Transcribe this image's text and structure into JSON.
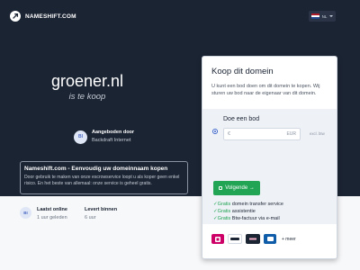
{
  "brand": {
    "name": "NAMESHIFT.COM"
  },
  "language": {
    "code": "NL",
    "flag_colors": [
      "#ae1c28",
      "#ffffff",
      "#21468b"
    ]
  },
  "hero": {
    "domain": "groener.nl",
    "tagline": "is te koop",
    "seller": {
      "initials": "BI",
      "title": "Aangeboden door",
      "name": "Backdraft Internet"
    }
  },
  "info": {
    "title": "Nameshift.com - Eenvoudig uw domeinnaam kopen",
    "text": "Door gebruik te maken van onze escrowservice loopt u als koper geen enkel risico. En het beste van allemaal: onze service is geheel gratis."
  },
  "footer": {
    "online": {
      "initials": "BI",
      "title": "Laatst online",
      "value": "1 uur geleden"
    },
    "delivery": {
      "title": "Levert binnen",
      "value": "6 uur"
    }
  },
  "card": {
    "title": "Koop dit domein",
    "text": "U kunt een bod doen om dit domein te kopen. Wij sturen uw bod naar de eigenaar van dit domein.",
    "bid_label": "Doe een bod",
    "currency": "€",
    "bid_placeholder": "",
    "bid_unit": "EUR",
    "vat_note": "excl. btw",
    "button_label": "Volgende →",
    "features": [
      {
        "free": "Gratis",
        "text": " domein transfer service"
      },
      {
        "free": "Gratis",
        "text": " assistentie"
      },
      {
        "free": "Gratis",
        "text": " Btw-factuur via e-mail"
      }
    ],
    "payments": [
      "ideal-logo",
      "paypal-logo",
      "klarna-logo",
      "giropay-logo"
    ],
    "payments_more": "+ meer"
  },
  "colors": {
    "background": "#1b2433",
    "accent": "#21a454",
    "link": "#3b63c9"
  }
}
